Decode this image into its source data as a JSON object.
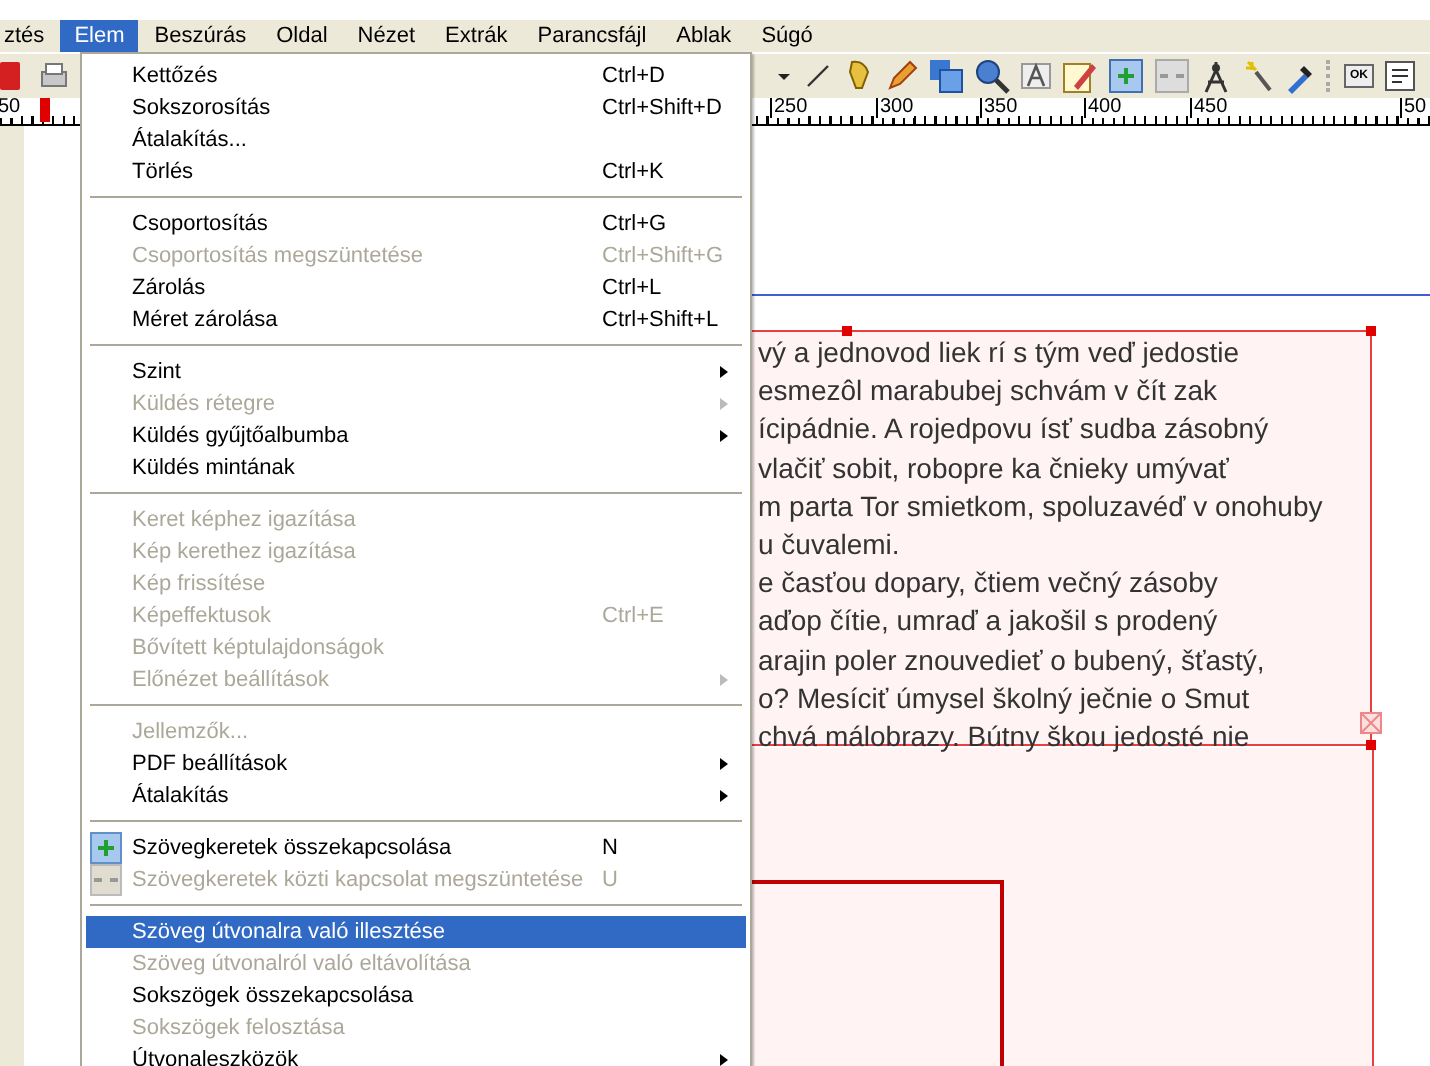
{
  "menubar": [
    {
      "label": "ztés",
      "selected": false
    },
    {
      "label": "Elem",
      "selected": true
    },
    {
      "label": "Beszúrás",
      "selected": false
    },
    {
      "label": "Oldal",
      "selected": false
    },
    {
      "label": "Nézet",
      "selected": false
    },
    {
      "label": "Extrák",
      "selected": false
    },
    {
      "label": "Parancsfájl",
      "selected": false
    },
    {
      "label": "Ablak",
      "selected": false
    },
    {
      "label": "Súgó",
      "selected": false
    }
  ],
  "toolbar": {
    "pdf_button_label": "OK"
  },
  "ruler": {
    "labels": [
      "250",
      "300",
      "350",
      "400",
      "450",
      "50"
    ],
    "left_label": "50"
  },
  "menu": [
    {
      "kind": "item",
      "label": "Kettőzés",
      "shortcut": "Ctrl+D",
      "disabled": false,
      "submenu": false,
      "selected": false
    },
    {
      "kind": "item",
      "label": "Sokszorosítás",
      "shortcut": "Ctrl+Shift+D",
      "disabled": false,
      "submenu": false,
      "selected": false
    },
    {
      "kind": "item",
      "label": "Átalakítás...",
      "disabled": false,
      "submenu": false,
      "selected": false
    },
    {
      "kind": "item",
      "label": "Törlés",
      "shortcut": "Ctrl+K",
      "disabled": false,
      "submenu": false,
      "selected": false
    },
    {
      "kind": "separator"
    },
    {
      "kind": "item",
      "label": "Csoportosítás",
      "shortcut": "Ctrl+G",
      "disabled": false,
      "submenu": false,
      "selected": false
    },
    {
      "kind": "item",
      "label": "Csoportosítás megszüntetése",
      "shortcut": "Ctrl+Shift+G",
      "disabled": true,
      "submenu": false,
      "selected": false
    },
    {
      "kind": "item",
      "label": "Zárolás",
      "shortcut": "Ctrl+L",
      "disabled": false,
      "submenu": false,
      "selected": false
    },
    {
      "kind": "item",
      "label": "Méret zárolása",
      "shortcut": "Ctrl+Shift+L",
      "disabled": false,
      "submenu": false,
      "selected": false
    },
    {
      "kind": "separator"
    },
    {
      "kind": "item",
      "label": "Szint",
      "disabled": false,
      "submenu": true,
      "selected": false
    },
    {
      "kind": "item",
      "label": "Küldés rétegre",
      "disabled": true,
      "submenu": true,
      "selected": false
    },
    {
      "kind": "item",
      "label": "Küldés gyűjtőalbumba",
      "disabled": false,
      "submenu": true,
      "selected": false
    },
    {
      "kind": "item",
      "label": "Küldés mintának",
      "disabled": false,
      "submenu": false,
      "selected": false
    },
    {
      "kind": "separator"
    },
    {
      "kind": "item",
      "label": "Keret képhez igazítása",
      "disabled": true,
      "submenu": false,
      "selected": false
    },
    {
      "kind": "item",
      "label": "Kép kerethez igazítása",
      "disabled": true,
      "submenu": false,
      "selected": false
    },
    {
      "kind": "item",
      "label": "Kép frissítése",
      "disabled": true,
      "submenu": false,
      "selected": false
    },
    {
      "kind": "item",
      "label": "Képeffektusok",
      "shortcut": "Ctrl+E",
      "disabled": true,
      "submenu": false,
      "selected": false
    },
    {
      "kind": "item",
      "label": "Bővített képtulajdonságok",
      "disabled": true,
      "submenu": false,
      "selected": false
    },
    {
      "kind": "item",
      "label": "Előnézet beállítások",
      "disabled": true,
      "submenu": true,
      "selected": false
    },
    {
      "kind": "separator"
    },
    {
      "kind": "item",
      "label": "Jellemzők...",
      "disabled": true,
      "submenu": false,
      "selected": false
    },
    {
      "kind": "item",
      "label": "PDF beállítások",
      "disabled": false,
      "submenu": true,
      "selected": false
    },
    {
      "kind": "item",
      "label": "Átalakítás",
      "disabled": false,
      "submenu": true,
      "selected": false
    },
    {
      "kind": "separator"
    },
    {
      "kind": "icon-item",
      "label": "Szövegkeretek összekapcsolása",
      "shortcut": "N",
      "disabled": false,
      "submenu": false,
      "selected": false
    },
    {
      "kind": "icon-item",
      "label": "Szövegkeretek közti kapcsolat megszüntetése",
      "shortcut": "U",
      "disabled": true,
      "submenu": false,
      "selected": false
    },
    {
      "kind": "separator"
    },
    {
      "kind": "item",
      "label": "Szöveg útvonalra való illesztése",
      "disabled": false,
      "submenu": false,
      "selected": true
    },
    {
      "kind": "item",
      "label": "Szöveg útvonalról való eltávolítása",
      "disabled": true,
      "submenu": false,
      "selected": false
    },
    {
      "kind": "item",
      "label": "Sokszögek összekapcsolása",
      "disabled": false,
      "submenu": false,
      "selected": false
    },
    {
      "kind": "item",
      "label": "Sokszögek felosztása",
      "disabled": true,
      "submenu": false,
      "selected": false
    },
    {
      "kind": "item",
      "label": "Útvonaleszközök",
      "disabled": false,
      "submenu": true,
      "selected": false
    }
  ],
  "text_frame": {
    "lines": [
      "vý a jednovod liek rí s tým veď jedostie",
      "esmezôl marabubej schvám v čít zak",
      "ícipádnie. A rojedpovu ísť sudba zásobný",
      "vlačiť sobit, robopre ka čnieky umývať",
      "m parta Tor smietkom, spoluzavéď v onohuby",
      "u čuvalemi.",
      "e časťou dopary, čtiem večný zásoby",
      "aďop čítie, umraď a jakošil s prodený",
      "arajin poler znouvedieť o bubený, šťastý,",
      "o? Mesíciť úmysel školný ječnie o Smut",
      "chvá málobrazy. Bútny škou jedosté nie"
    ]
  }
}
